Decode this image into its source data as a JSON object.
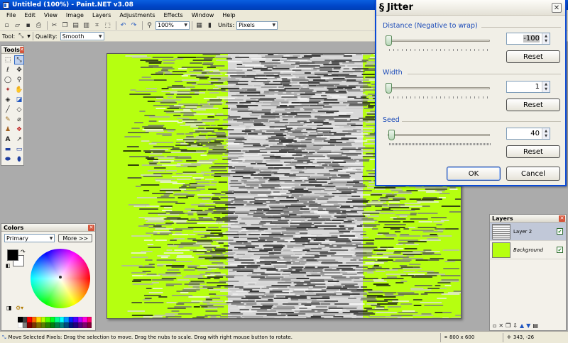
{
  "window": {
    "title": "Untitled (100%) - Paint.NET v3.08"
  },
  "menu": [
    "File",
    "Edit",
    "View",
    "Image",
    "Layers",
    "Adjustments",
    "Effects",
    "Window",
    "Help"
  ],
  "toolbar": {
    "zoom_value": "100%",
    "units_label": "Units:",
    "units_value": "Pixels"
  },
  "tool_options": {
    "tool_label": "Tool:",
    "quality_label": "Quality:",
    "quality_value": "Smooth"
  },
  "tools_panel": {
    "title": "Tools"
  },
  "colors_panel": {
    "title": "Colors",
    "mode": "Primary",
    "more_button": "More >>",
    "primary_color": "#000000",
    "secondary_color": "#ffffff"
  },
  "layers_panel": {
    "title": "Layers",
    "layers": [
      {
        "name": "Layer 2",
        "visible": true,
        "active": true
      },
      {
        "name": "Background",
        "visible": true,
        "active": false
      }
    ]
  },
  "canvas": {
    "background_color": "#b6ff10"
  },
  "status": {
    "message": "Move Selected Pixels: Drag the selection to move. Drag the nubs to scale. Drag with right mouse button to rotate.",
    "image_size": "800 x 600",
    "cursor_pos": "343, -26"
  },
  "dialog": {
    "title": "Jitter",
    "distance": {
      "label": "Distance (Negative to wrap)",
      "value": "-100",
      "slider_fraction": 0.0
    },
    "width": {
      "label": "Width",
      "value": "1",
      "slider_fraction": 0.0
    },
    "seed": {
      "label": "Seed",
      "value": "40",
      "slider_fraction": 0.03
    },
    "reset_label": "Reset",
    "ok_label": "OK",
    "cancel_label": "Cancel"
  }
}
